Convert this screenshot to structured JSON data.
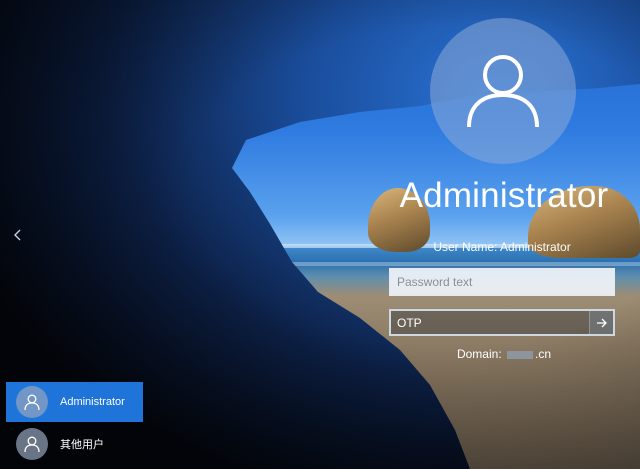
{
  "user": {
    "display_name": "Administrator",
    "username_label": "User Name:",
    "username_value": "Administrator"
  },
  "password_field": {
    "placeholder": "Password text",
    "value": ""
  },
  "otp_field": {
    "placeholder": "OTP",
    "submit_icon": "arrow-right-icon"
  },
  "domain": {
    "label": "Domain:",
    "suffix": ".cn"
  },
  "user_list": [
    {
      "label": "Administrator",
      "selected": true
    },
    {
      "label": "其他用户",
      "selected": false
    }
  ],
  "icons": {
    "back": "chevron-left-icon",
    "avatar": "user-icon"
  },
  "colors": {
    "selected_tile": "#1e74d8",
    "text": "#ffffff"
  }
}
